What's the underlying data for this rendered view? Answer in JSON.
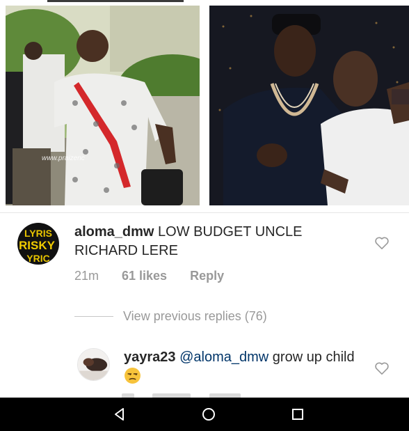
{
  "photos": {
    "left": {
      "watermark": "www.praizenc"
    },
    "right": {}
  },
  "comments": [
    {
      "avatar_text": "RISKY",
      "username": "aloma_dmw",
      "text": "LOW BUDGET UNCLE RICHARD LERE",
      "time": "21m",
      "likes": "61 likes",
      "reply": "Reply",
      "like_icon": "heart-outline-icon"
    },
    {
      "username": "yayra23",
      "mention": "@aloma_dmw",
      "text": "grow up child",
      "emoji": "unamused-face",
      "like_icon": "heart-outline-icon"
    }
  ],
  "view_previous": "View previous replies (76)",
  "navbar": {
    "back_icon": "back-triangle-icon",
    "home_icon": "home-circle-icon",
    "recents_icon": "recents-square-icon"
  }
}
